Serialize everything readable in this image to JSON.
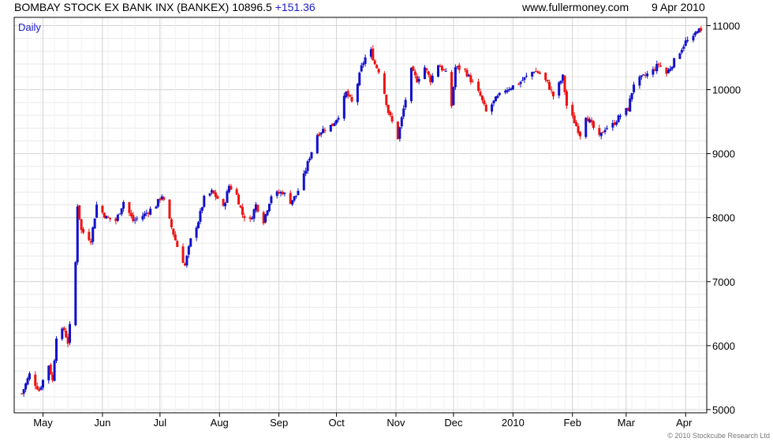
{
  "header": {
    "title": "BOMBAY STOCK EX BANK INX (BANKEX)",
    "last": "10896.5",
    "change": "+151.36",
    "site": "www.fullermoney.com",
    "date": "9 Apr 2010"
  },
  "footer": {
    "copyright": "© 2010 Stockcube Research Ltd"
  },
  "colors": {
    "up": "#1010cc",
    "down": "#ee1111",
    "grid": "#d4d4d4",
    "axis": "#000000",
    "label": "#1a1acc"
  },
  "chart_data": {
    "type": "candlestick",
    "period_label": "Daily",
    "ylim": [
      4950,
      11130
    ],
    "y_ticks": [
      5000,
      6000,
      7000,
      8000,
      9000,
      10000,
      11000
    ],
    "x_ticks": [
      "May",
      "Jun",
      "Jul",
      "Aug",
      "Sep",
      "Oct",
      "Nov",
      "Dec",
      "2010",
      "Feb",
      "Mar",
      "Apr"
    ],
    "grid": true,
    "close_path": [
      [
        "2009-04-20",
        5250
      ],
      [
        "2009-04-24",
        5550
      ],
      [
        "2009-04-29",
        5300
      ],
      [
        "2009-05-04",
        5700
      ],
      [
        "2009-05-06",
        5450
      ],
      [
        "2009-05-08",
        6150
      ],
      [
        "2009-05-12",
        6250
      ],
      [
        "2009-05-14",
        6050
      ],
      [
        "2009-05-15",
        6300
      ],
      [
        "2009-05-18",
        7300
      ],
      [
        "2009-05-19",
        8200
      ],
      [
        "2009-05-21",
        7800
      ],
      [
        "2009-05-26",
        7650
      ],
      [
        "2009-05-29",
        8200
      ],
      [
        "2009-06-03",
        8000
      ],
      [
        "2009-06-08",
        7950
      ],
      [
        "2009-06-12",
        8250
      ],
      [
        "2009-06-17",
        7950
      ],
      [
        "2009-06-23",
        8050
      ],
      [
        "2009-06-29",
        8200
      ],
      [
        "2009-07-02",
        8350
      ],
      [
        "2009-07-06",
        7950
      ],
      [
        "2009-07-10",
        7550
      ],
      [
        "2009-07-14",
        7250
      ],
      [
        "2009-07-17",
        7650
      ],
      [
        "2009-07-21",
        7950
      ],
      [
        "2009-07-24",
        8300
      ],
      [
        "2009-07-28",
        8400
      ],
      [
        "2009-07-31",
        8300
      ],
      [
        "2009-08-03",
        8150
      ],
      [
        "2009-08-06",
        8500
      ],
      [
        "2009-08-10",
        8350
      ],
      [
        "2009-08-13",
        8050
      ],
      [
        "2009-08-17",
        7950
      ],
      [
        "2009-08-20",
        8200
      ],
      [
        "2009-08-24",
        7950
      ],
      [
        "2009-08-28",
        8350
      ],
      [
        "2009-09-03",
        8400
      ],
      [
        "2009-09-07",
        8250
      ],
      [
        "2009-09-10",
        8350
      ],
      [
        "2009-09-14",
        8650
      ],
      [
        "2009-09-17",
        8950
      ],
      [
        "2009-09-21",
        9300
      ],
      [
        "2009-09-25",
        9400
      ],
      [
        "2009-09-29",
        9450
      ],
      [
        "2009-10-02",
        9600
      ],
      [
        "2009-10-06",
        9950
      ],
      [
        "2009-10-09",
        9800
      ],
      [
        "2009-10-12",
        10100
      ],
      [
        "2009-10-14",
        10350
      ],
      [
        "2009-10-16",
        10500
      ],
      [
        "2009-10-19",
        10600
      ],
      [
        "2009-10-21",
        10400
      ],
      [
        "2009-10-23",
        10300
      ],
      [
        "2009-10-26",
        9950
      ],
      [
        "2009-10-28",
        9650
      ],
      [
        "2009-11-02",
        9250
      ],
      [
        "2009-11-04",
        9550
      ],
      [
        "2009-11-06",
        9850
      ],
      [
        "2009-11-09",
        10300
      ],
      [
        "2009-11-12",
        10150
      ],
      [
        "2009-11-16",
        10350
      ],
      [
        "2009-11-19",
        10150
      ],
      [
        "2009-11-23",
        10400
      ],
      [
        "2009-11-27",
        10250
      ],
      [
        "2009-11-30",
        9750
      ],
      [
        "2009-12-02",
        10350
      ],
      [
        "2009-12-07",
        10300
      ],
      [
        "2009-12-11",
        10100
      ],
      [
        "2009-12-15",
        9900
      ],
      [
        "2009-12-18",
        9650
      ],
      [
        "2009-12-23",
        9850
      ],
      [
        "2009-12-28",
        10000
      ],
      [
        "2010-01-04",
        10100
      ],
      [
        "2010-01-08",
        10200
      ],
      [
        "2010-01-12",
        10300
      ],
      [
        "2010-01-15",
        10250
      ],
      [
        "2010-01-19",
        10100
      ],
      [
        "2010-01-22",
        9900
      ],
      [
        "2010-01-27",
        10200
      ],
      [
        "2010-01-29",
        9750
      ],
      [
        "2010-02-02",
        9500
      ],
      [
        "2010-02-05",
        9300
      ],
      [
        "2010-02-08",
        9600
      ],
      [
        "2010-02-11",
        9450
      ],
      [
        "2010-02-15",
        9250
      ],
      [
        "2010-02-18",
        9400
      ],
      [
        "2010-02-22",
        9450
      ],
      [
        "2010-02-26",
        9600
      ],
      [
        "2010-03-02",
        9700
      ],
      [
        "2010-03-05",
        10100
      ],
      [
        "2010-03-10",
        10200
      ],
      [
        "2010-03-15",
        10300
      ],
      [
        "2010-03-18",
        10400
      ],
      [
        "2010-03-22",
        10250
      ],
      [
        "2010-03-25",
        10400
      ],
      [
        "2010-03-29",
        10600
      ],
      [
        "2010-04-01",
        10750
      ],
      [
        "2010-04-05",
        10800
      ],
      [
        "2010-04-07",
        10950
      ],
      [
        "2010-04-09",
        10896.5
      ]
    ]
  }
}
